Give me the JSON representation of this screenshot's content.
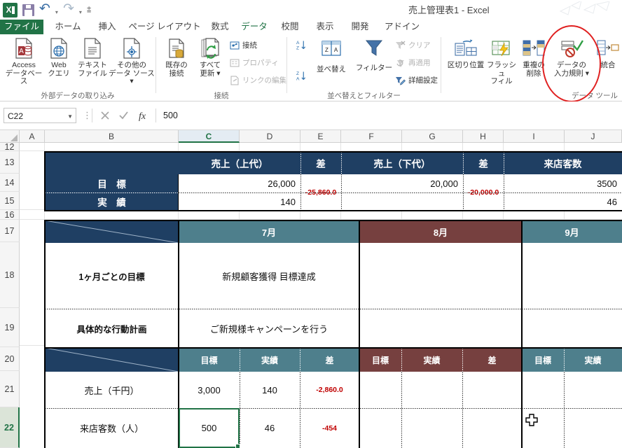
{
  "window": {
    "title": "売上管理表1 - Excel"
  },
  "quick_access": {
    "excel_icon": "excel-icon",
    "save_label": "save-icon",
    "undo_label": "undo-icon",
    "redo_label": "redo-icon",
    "customize_label": "customize-qat-icon"
  },
  "tabs": [
    {
      "label": "ファイル",
      "active": false
    },
    {
      "label": "ホーム",
      "active": false
    },
    {
      "label": "挿入",
      "active": false
    },
    {
      "label": "ページ レイアウト",
      "active": false
    },
    {
      "label": "数式",
      "active": false
    },
    {
      "label": "データ",
      "active": true
    },
    {
      "label": "校閲",
      "active": false
    },
    {
      "label": "表示",
      "active": false
    },
    {
      "label": "開発",
      "active": false
    },
    {
      "label": "アドイン",
      "active": false
    }
  ],
  "ribbon": {
    "groups": [
      {
        "name": "外部データの取り込み",
        "buttons": [
          {
            "label": "Access\nデータベース",
            "icon": "access-database-icon"
          },
          {
            "label": "Web\nクエリ",
            "icon": "web-query-icon"
          },
          {
            "label": "テキスト\nファイル",
            "icon": "text-file-icon"
          },
          {
            "label": "その他の\nデータ ソース ▾",
            "icon": "other-data-sources-icon"
          }
        ]
      },
      {
        "name": "接続",
        "buttons": [
          {
            "label": "既存の\n接続",
            "icon": "existing-connections-icon"
          },
          {
            "label": "すべて\n更新 ▾",
            "icon": "refresh-all-icon"
          }
        ],
        "small_buttons": [
          {
            "label": "接続",
            "icon": "connections-icon",
            "disabled": false
          },
          {
            "label": "プロパティ",
            "icon": "properties-icon",
            "disabled": true
          },
          {
            "label": "リンクの編集",
            "icon": "edit-links-icon",
            "disabled": true
          }
        ]
      },
      {
        "name": "並べ替えとフィルター",
        "buttons": [
          {
            "label": "並べ替え",
            "icon": "sort-icon"
          },
          {
            "label": "フィルター",
            "icon": "filter-icon"
          }
        ],
        "small_buttons": [
          {
            "label": "クリア",
            "icon": "clear-filter-icon",
            "disabled": true
          },
          {
            "label": "再適用",
            "icon": "reapply-icon",
            "disabled": true
          },
          {
            "label": "詳細設定",
            "icon": "advanced-filter-icon",
            "disabled": false
          }
        ],
        "sort_az": "A→Z",
        "sort_za": "Z→A"
      },
      {
        "name": "データ ツール",
        "buttons": [
          {
            "label": "区切り位置",
            "icon": "text-to-columns-icon"
          },
          {
            "label": "フラッシュ\nフィル",
            "icon": "flash-fill-icon"
          },
          {
            "label": "重複の\n削除",
            "icon": "remove-duplicates-icon"
          },
          {
            "label": "データの\n入力規則 ▾",
            "icon": "data-validation-icon",
            "highlighted": true
          },
          {
            "label": "統合",
            "icon": "consolidate-icon"
          }
        ]
      }
    ]
  },
  "formula_bar": {
    "name_box": "C22",
    "cancel_icon": "cancel-icon",
    "enter_icon": "enter-icon",
    "function_icon": "insert-function-icon",
    "value": "500"
  },
  "grid": {
    "columns": [
      "A",
      "B",
      "C",
      "D",
      "E",
      "F",
      "G",
      "H",
      "I",
      "J"
    ],
    "selected_column": "C",
    "rows": [
      "12",
      "13",
      "14",
      "15",
      "16",
      "17",
      "18",
      "19",
      "20",
      "21",
      "22"
    ],
    "selected_row": "22",
    "selected_cell": "C22",
    "summary_table": {
      "headers": {
        "sales_upper": "売上（上代）",
        "diff1": "差",
        "sales_lower": "売上（下代）",
        "diff2": "差",
        "visitors": "来店客数"
      },
      "row_labels": [
        "目　標",
        "実　績"
      ],
      "target": {
        "sales_upper": "26,000",
        "sales_lower": "20,000",
        "visitors": "3500"
      },
      "actual": {
        "sales_upper": "140",
        "sales_lower": "",
        "visitors": "46"
      },
      "diffs": {
        "diff1": "-25,860.0",
        "diff2": "-20,000.0"
      }
    },
    "monthly_table": {
      "months": [
        {
          "label": "7月",
          "color": "teal"
        },
        {
          "label": "8月",
          "color": "maroon"
        },
        {
          "label": "9月",
          "color": "teal"
        }
      ],
      "plan_rows": [
        {
          "label": "1ヶ月ごとの目標",
          "july": "新規顧客獲得 目標達成",
          "august": "",
          "september": ""
        },
        {
          "label": "具体的な行動計画",
          "july": "ご新規様キャンペーンを行う",
          "august": "",
          "september": ""
        }
      ],
      "sub_headers": [
        "目標",
        "実績",
        "差"
      ],
      "data_rows": [
        {
          "label": "売上（千円）",
          "july": {
            "target": "3,000",
            "actual": "140",
            "diff": "-2,860.0"
          },
          "august": {
            "target": "",
            "actual": "",
            "diff": ""
          },
          "september": {
            "target": "",
            "actual": ""
          }
        },
        {
          "label": "来店客数（人）",
          "july": {
            "target": "500",
            "actual": "46",
            "diff": "-454"
          },
          "august": {
            "target": "",
            "actual": "",
            "diff": ""
          },
          "september": {
            "target": "",
            "actual": ""
          }
        }
      ]
    }
  },
  "colors": {
    "header_navy": "#1f3f63",
    "teal": "#4e7f8c",
    "maroon": "#76403f",
    "negative_red": "#c00000",
    "excel_green": "#217346",
    "annotation_red": "#e02020"
  }
}
